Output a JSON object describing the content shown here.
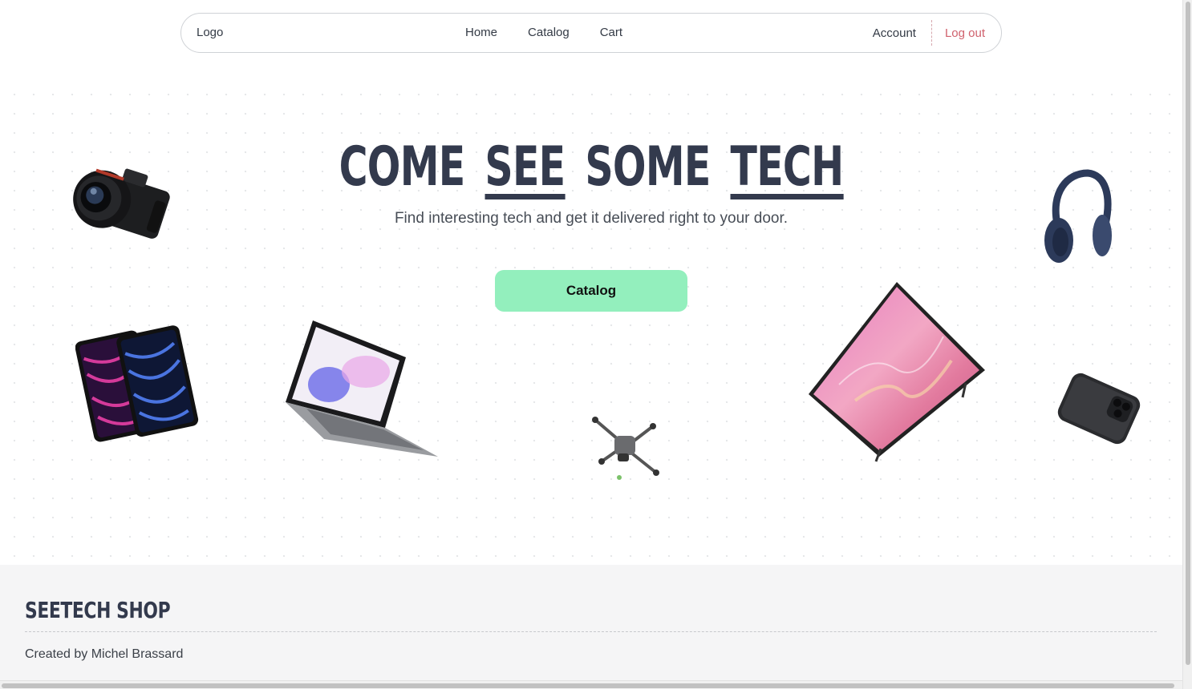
{
  "nav": {
    "logo": "Logo",
    "links": [
      "Home",
      "Catalog",
      "Cart"
    ],
    "account": "Account",
    "logout": "Log out"
  },
  "hero": {
    "headline": [
      "COME",
      "SEE",
      "SOME",
      "TECH"
    ],
    "subtitle": "Find interesting tech and get it delivered right to your door.",
    "cta": "Catalog"
  },
  "products": [
    "camera-image",
    "headphones-image",
    "tablets-image",
    "laptop-image",
    "drone-image",
    "tv-image",
    "phone-image"
  ],
  "footer": {
    "brand": "SEETECH SHOP",
    "credit": "Created by Michel Brassard"
  },
  "colors": {
    "text": "#333a4d",
    "logout": "#d0616d",
    "cta": "#93efbd",
    "footer_bg": "#f5f5f6"
  }
}
